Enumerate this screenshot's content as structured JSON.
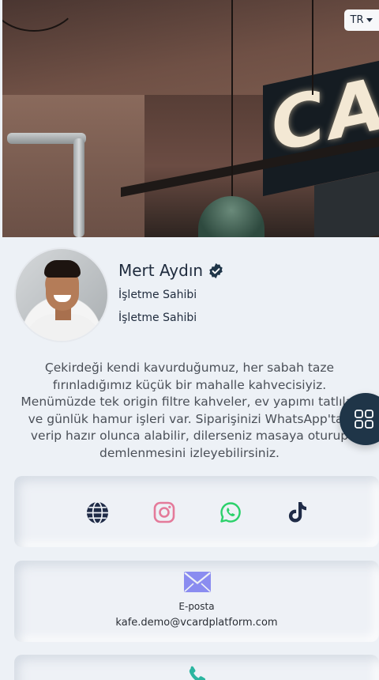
{
  "language": {
    "selected": "TR"
  },
  "profile": {
    "name": "Mert Aydın",
    "roles": [
      "İşletme Sahibi",
      "İşletme Sahibi"
    ],
    "description": "Çekirdeği kendi kavurduğumuz, her sabah taze fırınladığımız küçük bir mahalle kahvecisiyiz. Menümüzde tek origin filtre kahveler, ev yapımı tatlılar ve günlük hamur işleri var. Siparişinizi WhatsApp'tan verip hazır olunca alabilir, dilerseniz masaya oturup demlenmesini izleyebilirsiniz."
  },
  "social": {
    "icons": [
      "globe-icon",
      "instagram-icon",
      "whatsapp-icon",
      "tiktok-icon"
    ],
    "colors": {
      "globe": "#1f2b47",
      "instagram": "#e47a9a",
      "whatsapp": "#2bd16a",
      "tiktok": "#1f2b47"
    }
  },
  "contact": {
    "email_label": "E-posta",
    "email_value": "kafe.demo@vcardplatform.com",
    "email_icon_color": "#8a8cf0",
    "phone_icon_color": "#2bb5a0"
  },
  "cover": {
    "sign_text": "CA"
  },
  "accent": "#1f3548"
}
